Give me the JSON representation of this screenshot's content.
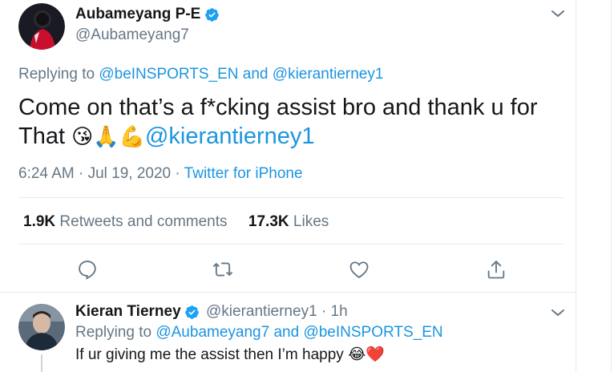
{
  "main_tweet": {
    "author_name": "Aubameyang P-E",
    "handle": "@Aubameyang7",
    "replying_prefix": "Replying to",
    "replying_user1": "@beINSPORTS_EN",
    "replying_and": "and",
    "replying_user2": "@kierantierney1",
    "text_line": "Come on that’s a f*cking assist bro and thank u for That",
    "emoji_1": "😘",
    "emoji_2": "🙏",
    "emoji_3": "💪",
    "mention": "@kierantierney1",
    "timestamp": "6:24 AM · Jul 19, 2020 ·",
    "source": "Twitter for iPhone",
    "retweets_count": "1.9K",
    "retweets_label": "Retweets and comments",
    "likes_count": "17.3K",
    "likes_label": "Likes"
  },
  "reply_tweet": {
    "author_name": "Kieran Tierney",
    "handle_time": "@kierantierney1 · 1h",
    "replying_prefix": "Replying to",
    "replying_user1": "@Aubameyang7",
    "replying_and": "and",
    "replying_user2": "@beINSPORTS_EN",
    "text": "If ur giving me the assist then I’m happy",
    "emoji_1": "😂",
    "emoji_2": "❤️"
  },
  "colors": {
    "link": "#1b95e0",
    "muted": "#657786",
    "text": "#14171a",
    "verified": "#1da1f2",
    "divider": "#e6ecf0"
  },
  "icons": {
    "actions": [
      "reply-icon",
      "retweet-icon",
      "like-icon",
      "share-icon"
    ],
    "verified": "verified-badge-icon",
    "caret": "chevron-down-icon"
  }
}
